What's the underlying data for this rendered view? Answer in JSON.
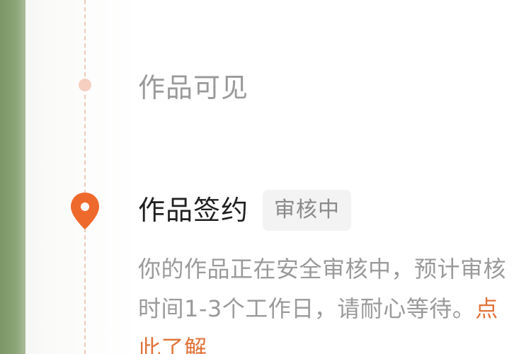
{
  "colors": {
    "accent": "#ee6a2c",
    "muted_text": "#9a9a9a",
    "title_text": "#1f1f1f",
    "link": "#e0733a",
    "timeline": "#f3c9b8"
  },
  "steps": [
    {
      "title": "作品可见",
      "state": "done",
      "icon": "dot-icon"
    },
    {
      "title": "作品签约",
      "state": "active",
      "badge": "审核中",
      "icon": "location-pin-icon",
      "description": "你的作品正在安全审核中，预计审核时间1-3个工作日，请耐心等待。",
      "link_label": "点此了解"
    }
  ]
}
